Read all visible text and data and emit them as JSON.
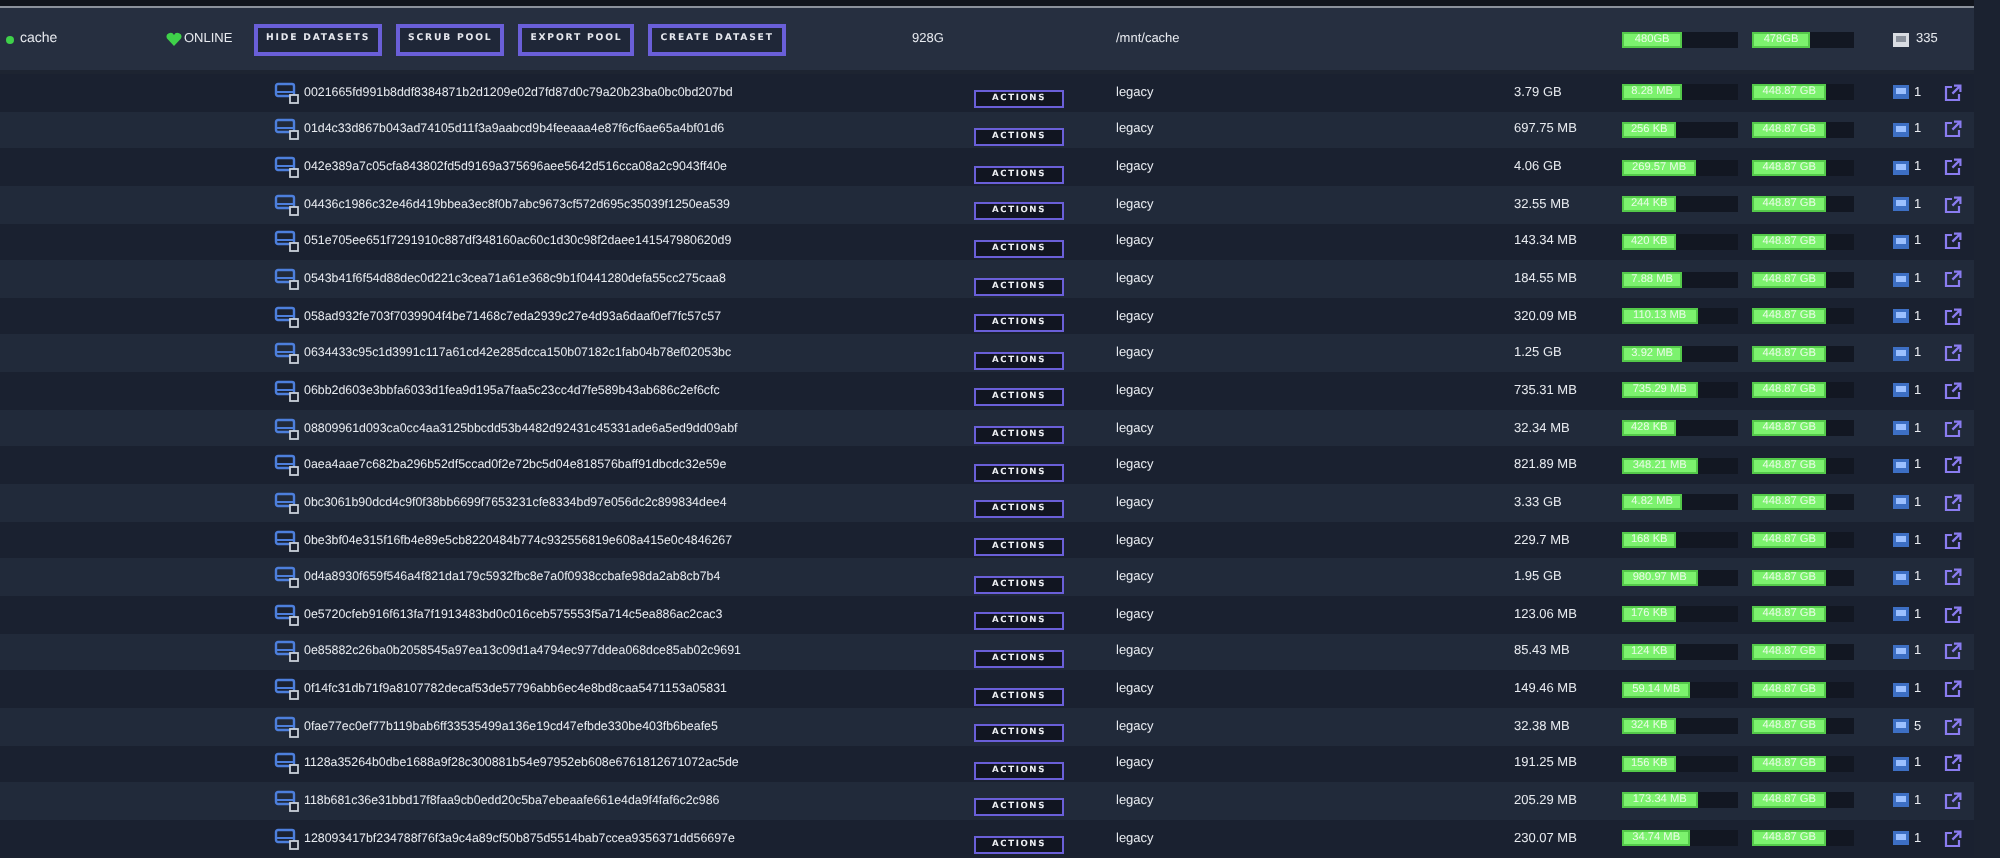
{
  "pool": {
    "name": "cache",
    "online": true,
    "status": "ONLINE",
    "buttons": [
      "HIDE DATASETS",
      "SCRUB POOL",
      "EXPORT POOL",
      "CREATE DATASET"
    ],
    "size": "928G",
    "path": "/mnt/cache",
    "used": {
      "label": "480GB",
      "level": 0.52
    },
    "free": {
      "label": "478GB",
      "level": 0.57
    },
    "disk_count": "335"
  },
  "datasets": [
    {
      "name": "0021665fd991b8ddf8384871b2d1209e02d7fd87d0c79a20b23ba0bc0bd207bd",
      "action": "ACTIONS",
      "type": "legacy",
      "size": "3.79 GB",
      "used": {
        "label": "8.28 MB",
        "level": 0.52
      },
      "free": {
        "label": "448.87 GB",
        "level": 0.73
      },
      "disk_count": "1"
    },
    {
      "name": "01d4c33d867b043ad74105d11f3a9aabcd9b4feeaaa4e87f6cf6ae65a4bf01d6",
      "action": "ACTIONS",
      "type": "legacy",
      "size": "697.75 MB",
      "used": {
        "label": "256 KB",
        "level": 0.47
      },
      "free": {
        "label": "448.87 GB",
        "level": 0.73
      },
      "disk_count": "1"
    },
    {
      "name": "042e389a7c05cfa843802fd5d9169a375696aee5642d516cca08a2c9043ff40e",
      "action": "ACTIONS",
      "type": "legacy",
      "size": "4.06 GB",
      "used": {
        "label": "269.57 MB",
        "level": 0.64
      },
      "free": {
        "label": "448.87 GB",
        "level": 0.73
      },
      "disk_count": "1"
    },
    {
      "name": "04436c1986c32e46d419bbea3ec8f0b7abc9673cf572d695c35039f1250ea539",
      "action": "ACTIONS",
      "type": "legacy",
      "size": "32.55 MB",
      "used": {
        "label": "244 KB",
        "level": 0.47
      },
      "free": {
        "label": "448.87 GB",
        "level": 0.73
      },
      "disk_count": "1"
    },
    {
      "name": "051e705ee651f7291910c887df348160ac60c1d30c98f2daee141547980620d9",
      "action": "ACTIONS",
      "type": "legacy",
      "size": "143.34 MB",
      "used": {
        "label": "420 KB",
        "level": 0.47
      },
      "free": {
        "label": "448.87 GB",
        "level": 0.73
      },
      "disk_count": "1"
    },
    {
      "name": "0543b41f6f54d88dec0d221c3cea71a61e368c9b1f0441280defa55cc275caa8",
      "action": "ACTIONS",
      "type": "legacy",
      "size": "184.55 MB",
      "used": {
        "label": "7.88 MB",
        "level": 0.52
      },
      "free": {
        "label": "448.87 GB",
        "level": 0.73
      },
      "disk_count": "1"
    },
    {
      "name": "058ad932fe703f7039904f4be71468c7eda2939c27e4d93a6daaf0ef7fc57c57",
      "action": "ACTIONS",
      "type": "legacy",
      "size": "320.09 MB",
      "used": {
        "label": "110.13 MB",
        "level": 0.65
      },
      "free": {
        "label": "448.87 GB",
        "level": 0.73
      },
      "disk_count": "1"
    },
    {
      "name": "0634433c95c1d3991c117a61cd42e285dcca150b07182c1fab04b78ef02053bc",
      "action": "ACTIONS",
      "type": "legacy",
      "size": "1.25 GB",
      "used": {
        "label": "3.92 MB",
        "level": 0.52
      },
      "free": {
        "label": "448.87 GB",
        "level": 0.73
      },
      "disk_count": "1"
    },
    {
      "name": "06bb2d603e3bbfa6033d1fea9d195a7faa5c23cc4d7fe589b43ab686c2ef6cfc",
      "action": "ACTIONS",
      "type": "legacy",
      "size": "735.31 MB",
      "used": {
        "label": "735.29 MB",
        "level": 0.65
      },
      "free": {
        "label": "448.87 GB",
        "level": 0.73
      },
      "disk_count": "1"
    },
    {
      "name": "08809961d093ca0cc4aa3125bbcdd53b4482d92431c45331ade6a5ed9dd09abf",
      "action": "ACTIONS",
      "type": "legacy",
      "size": "32.34 MB",
      "used": {
        "label": "428 KB",
        "level": 0.47
      },
      "free": {
        "label": "448.87 GB",
        "level": 0.73
      },
      "disk_count": "1"
    },
    {
      "name": "0aea4aae7c682ba296b52df5ccad0f2e72bc5d04e818576baff91dbcdc32e59e",
      "action": "ACTIONS",
      "type": "legacy",
      "size": "821.89 MB",
      "used": {
        "label": "348.21 MB",
        "level": 0.65
      },
      "free": {
        "label": "448.87 GB",
        "level": 0.73
      },
      "disk_count": "1"
    },
    {
      "name": "0bc3061b90dcd4c9f0f38bb6699f7653231cfe8334bd97e056dc2c899834dee4",
      "action": "ACTIONS",
      "type": "legacy",
      "size": "3.33 GB",
      "used": {
        "label": "4.82 MB",
        "level": 0.52
      },
      "free": {
        "label": "448.87 GB",
        "level": 0.73
      },
      "disk_count": "1"
    },
    {
      "name": "0be3bf04e315f16fb4e89e5cb8220484b774c932556819e608a415e0c4846267",
      "action": "ACTIONS",
      "type": "legacy",
      "size": "229.7 MB",
      "used": {
        "label": "168 KB",
        "level": 0.47
      },
      "free": {
        "label": "448.87 GB",
        "level": 0.73
      },
      "disk_count": "1"
    },
    {
      "name": "0d4a8930f659f546a4f821da179c5932fbc8e7a0f0938ccbafe98da2ab8cb7b4",
      "action": "ACTIONS",
      "type": "legacy",
      "size": "1.95 GB",
      "used": {
        "label": "980.97 MB",
        "level": 0.65
      },
      "free": {
        "label": "448.87 GB",
        "level": 0.73
      },
      "disk_count": "1"
    },
    {
      "name": "0e5720cfeb916f613fa7f1913483bd0c016ceb575553f5a714c5ea886ac2cac3",
      "action": "ACTIONS",
      "type": "legacy",
      "size": "123.06 MB",
      "used": {
        "label": "176 KB",
        "level": 0.47
      },
      "free": {
        "label": "448.87 GB",
        "level": 0.73
      },
      "disk_count": "1"
    },
    {
      "name": "0e85882c26ba0b2058545a97ea13c09d1a4794ec977ddea068dce85ab02c9691",
      "action": "ACTIONS",
      "type": "legacy",
      "size": "85.43 MB",
      "used": {
        "label": "124 KB",
        "level": 0.47
      },
      "free": {
        "label": "448.87 GB",
        "level": 0.73
      },
      "disk_count": "1"
    },
    {
      "name": "0f14fc31db71f9a8107782decaf53de57796abb6ec4e8bd8caa5471153a05831",
      "action": "ACTIONS",
      "type": "legacy",
      "size": "149.46 MB",
      "used": {
        "label": "59.14 MB",
        "level": 0.59
      },
      "free": {
        "label": "448.87 GB",
        "level": 0.73
      },
      "disk_count": "1"
    },
    {
      "name": "0fae77ec0ef77b119bab6ff33535499a136e19cd47efbde330be403fb6beafe5",
      "action": "ACTIONS",
      "type": "legacy",
      "size": "32.38 MB",
      "used": {
        "label": "324 KB",
        "level": 0.47
      },
      "free": {
        "label": "448.87 GB",
        "level": 0.73
      },
      "disk_count": "5"
    },
    {
      "name": "1128a35264b0dbe1688a9f28c300881b54e97952eb608e6761812671072ac5de",
      "action": "ACTIONS",
      "type": "legacy",
      "size": "191.25 MB",
      "used": {
        "label": "156 KB",
        "level": 0.47
      },
      "free": {
        "label": "448.87 GB",
        "level": 0.73
      },
      "disk_count": "1"
    },
    {
      "name": "118b681c36e31bbd17f8faa9cb0edd20c5ba7ebeaafe661e4da9f4faf6c2c986",
      "action": "ACTIONS",
      "type": "legacy",
      "size": "205.29 MB",
      "used": {
        "label": "173.34 MB",
        "level": 0.65
      },
      "free": {
        "label": "448.87 GB",
        "level": 0.73
      },
      "disk_count": "1"
    },
    {
      "name": "128093417bf234788f76f3a9c4a89cf50b875d5514bab7ccea9356371dd56697e",
      "action": "ACTIONS",
      "type": "legacy",
      "size": "230.07 MB",
      "used": {
        "label": "34.74 MB",
        "level": 0.59
      },
      "free": {
        "label": "448.87 GB",
        "level": 0.73
      },
      "disk_count": "1"
    }
  ]
}
